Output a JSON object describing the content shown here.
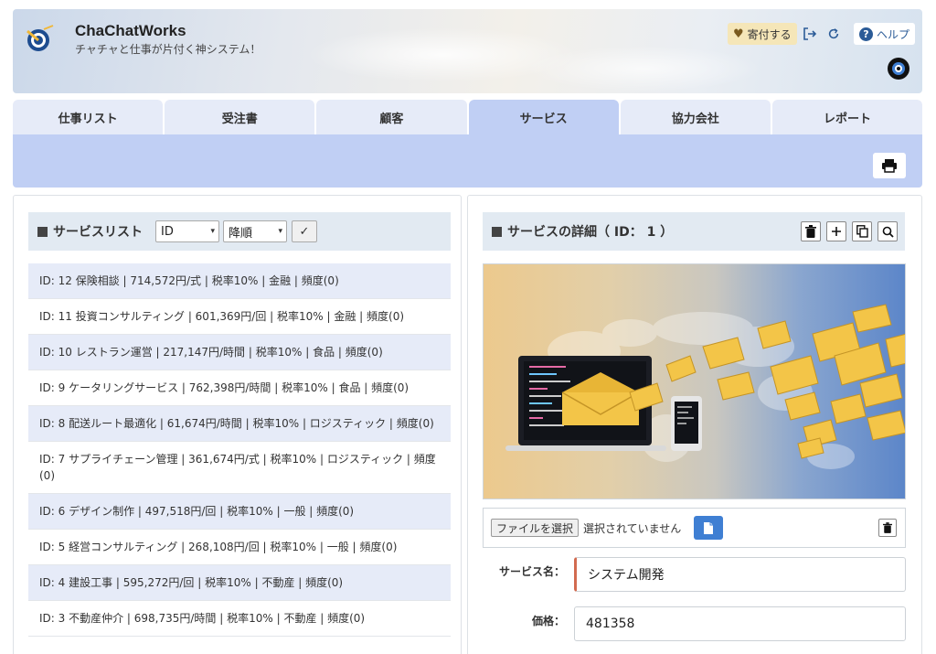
{
  "app": {
    "title": "ChaChatWorks",
    "subtitle": "チャチャと仕事が片付く神システム！"
  },
  "header": {
    "donate_label": "寄付する",
    "help_label": "ヘルプ",
    "icons": [
      "heart-icon",
      "logout-icon",
      "refresh-icon",
      "help-icon",
      "user-avatar"
    ]
  },
  "tabs": [
    {
      "label": "仕事リスト",
      "active": false
    },
    {
      "label": "受注書",
      "active": false
    },
    {
      "label": "顧客",
      "active": false
    },
    {
      "label": "サービス",
      "active": true
    },
    {
      "label": "協力会社",
      "active": false
    },
    {
      "label": "レポート",
      "active": false
    }
  ],
  "service_list": {
    "title": "サービスリスト",
    "sort_field": "ID",
    "sort_order": "降順",
    "apply_label": "✓",
    "items": [
      "ID: 12 保険相談 | 714,572円/式 | 税率10% | 金融 | 頻度(0)",
      "ID: 11 投資コンサルティング | 601,369円/回 | 税率10% | 金融 | 頻度(0)",
      "ID: 10 レストラン運営 | 217,147円/時間 | 税率10% | 食品 | 頻度(0)",
      "ID: 9 ケータリングサービス | 762,398円/時間 | 税率10% | 食品 | 頻度(0)",
      "ID: 8 配送ルート最適化 | 61,674円/時間 | 税率10% | ロジスティック | 頻度(0)",
      "ID: 7 サプライチェーン管理 | 361,674円/式 | 税率10% | ロジスティック | 頻度(0)",
      "ID: 6 デザイン制作 | 497,518円/回 | 税率10% | 一般 | 頻度(0)",
      "ID: 5 経営コンサルティング | 268,108円/回 | 税率10% | 一般 | 頻度(0)",
      "ID: 4 建設工事 | 595,272円/回 | 税率10% | 不動産 | 頻度(0)",
      "ID: 3 不動産仲介 | 698,735円/時間 | 税率10% | 不動産 | 頻度(0)"
    ]
  },
  "service_detail": {
    "title": "サービスの詳細（ ID： 1 ）",
    "file_button": "ファイルを選択",
    "file_status": "選択されていません",
    "fields": {
      "name_label": "サービス名：",
      "name_value": "システム開発",
      "price_label": "価格：",
      "price_value": "481358"
    }
  },
  "colors": {
    "tab_active": "#c0cff4",
    "tab_inactive": "#e6ebf8",
    "row_alt": "#e6ebf8",
    "primary_button": "#3f7fd3",
    "focus_accent": "#d26b50"
  }
}
